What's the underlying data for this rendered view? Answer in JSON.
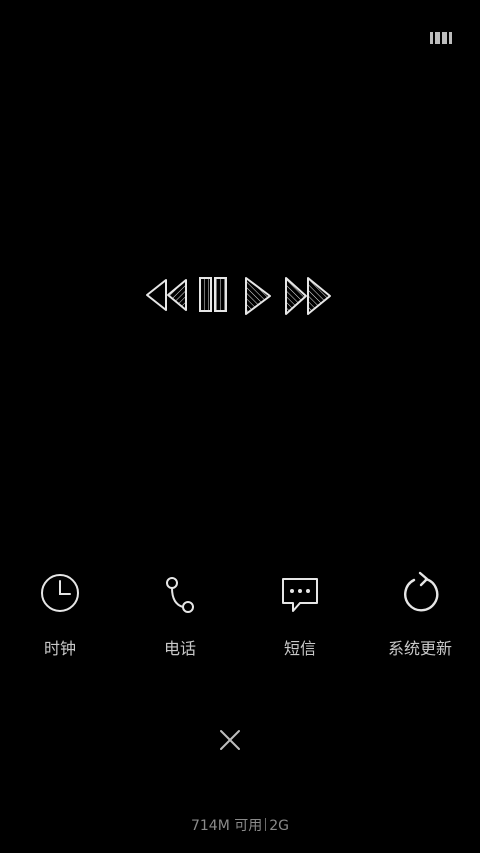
{
  "top_icon": {
    "name": "recents-grid-icon"
  },
  "media": {
    "controls": [
      "previous-icon",
      "pause-icon",
      "play-icon",
      "next-icon"
    ]
  },
  "apps": [
    {
      "label": "时钟",
      "icon": "clock-icon"
    },
    {
      "label": "电话",
      "icon": "phone-icon"
    },
    {
      "label": "短信",
      "icon": "message-icon"
    },
    {
      "label": "系统更新",
      "icon": "refresh-icon"
    }
  ],
  "close": {
    "icon": "close-icon"
  },
  "memory": {
    "available": "714M 可用",
    "total": "2G"
  },
  "colors": {
    "background": "#000000",
    "icon_stroke": "#e6e6e6",
    "label": "#c8c8c8",
    "memory_text": "#8a8a8a"
  }
}
